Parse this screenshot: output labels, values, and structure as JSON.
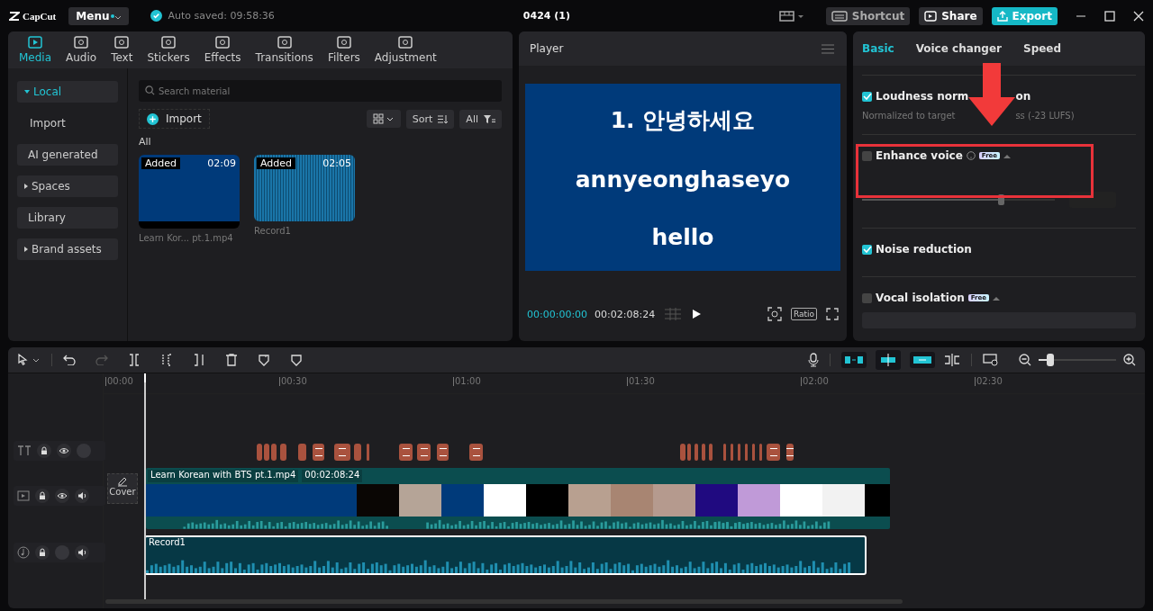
{
  "app": {
    "logo": "CapCut",
    "menu": "Menu",
    "autosave": "Auto saved: 09:58:36",
    "project": "0424 (1)",
    "shortcut": "Shortcut",
    "share": "Share",
    "export": "Export"
  },
  "tool_tabs": [
    {
      "label": "Media",
      "selected": true
    },
    {
      "label": "Audio",
      "selected": false
    },
    {
      "label": "Text",
      "selected": false
    },
    {
      "label": "Stickers",
      "selected": false
    },
    {
      "label": "Effects",
      "selected": false
    },
    {
      "label": "Transitions",
      "selected": false
    },
    {
      "label": "Filters",
      "selected": false
    },
    {
      "label": "Adjustment",
      "selected": false
    }
  ],
  "sidebar": [
    {
      "label": "Local",
      "selected": true,
      "kind": "expander"
    },
    {
      "label": "Import",
      "selected": false,
      "kind": "plain"
    },
    {
      "label": "AI generated",
      "selected": false,
      "kind": "item"
    },
    {
      "label": "Spaces",
      "selected": false,
      "kind": "expander"
    },
    {
      "label": "Library",
      "selected": false,
      "kind": "item"
    },
    {
      "label": "Brand assets",
      "selected": false,
      "kind": "expander"
    }
  ],
  "media": {
    "search": {
      "placeholder": "Search material"
    },
    "import": "Import",
    "sort": "Sort",
    "filter": "All",
    "section": "All",
    "items": [
      {
        "kind": "video",
        "badge": "Added",
        "duration": "02:09",
        "name": "Learn Kor... pt.1.mp4"
      },
      {
        "kind": "audio",
        "badge": "Added",
        "duration": "02:05",
        "name": "Record1"
      }
    ]
  },
  "player": {
    "title": "Player",
    "lines": [
      "1. 안녕하세요",
      "annyeonghaseyo",
      "hello"
    ],
    "current": "00:00:00:00",
    "total": "00:02:08:24",
    "ratio": "Ratio"
  },
  "inspector": {
    "tabs": [
      {
        "label": "Basic",
        "selected": true
      },
      {
        "label": "Voice changer",
        "selected": false
      },
      {
        "label": "Speed",
        "selected": false
      }
    ],
    "options": [
      {
        "kind": "note",
        "checked": true,
        "label_parts": [
          "Loudness norm",
          "on"
        ],
        "note_parts": [
          "Normalized to target",
          "ss (-23 LUFS)"
        ]
      },
      {
        "kind": "slider",
        "checked": false,
        "label": "Enhance voice",
        "badge": "Free",
        "level": 0.74
      },
      {
        "kind": "plain",
        "checked": true,
        "label": "Noise reduction"
      },
      {
        "kind": "select",
        "checked": false,
        "label": "Vocal isolation",
        "badge": "Free"
      }
    ]
  },
  "timeline": {
    "ticks": [
      "00:00",
      "00:30",
      "01:00",
      "01:30",
      "02:00",
      "02:30"
    ],
    "cover": "Cover",
    "zoom": {
      "level": 0.2
    },
    "video_clip": {
      "name": "Learn Korean with BTS pt.1.mp4",
      "duration": "00:02:08:24"
    },
    "audio_clip": {
      "name": "Record1"
    }
  }
}
